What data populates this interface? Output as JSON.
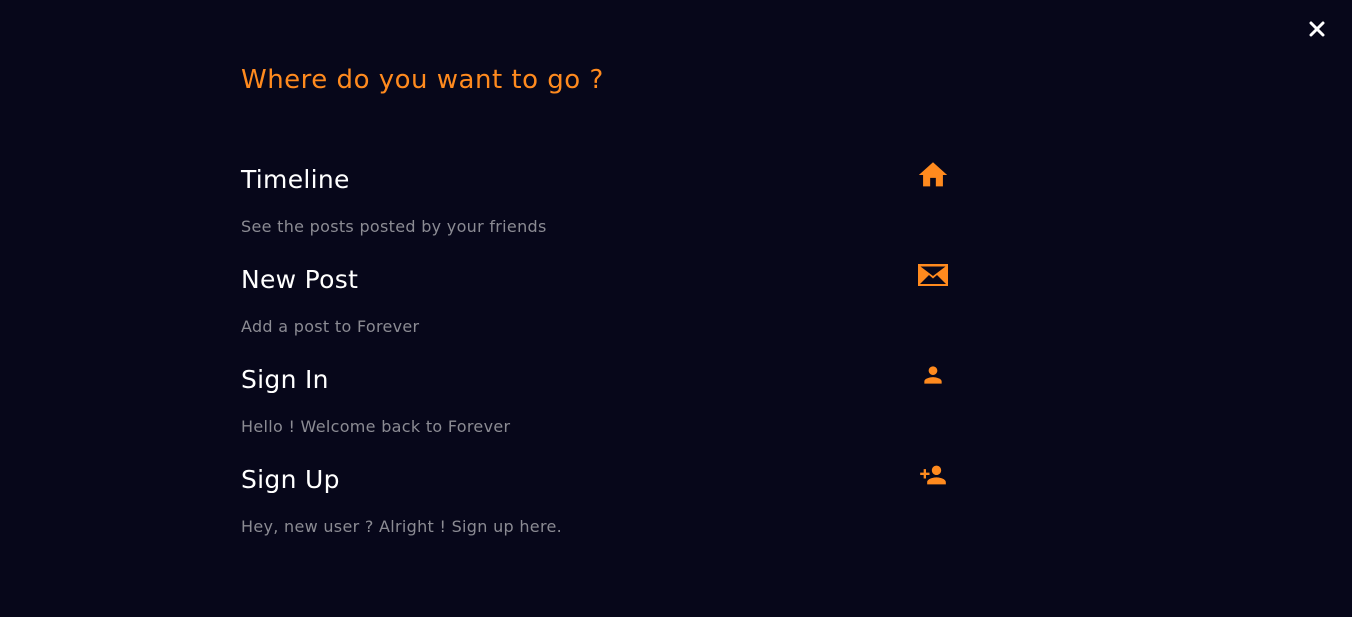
{
  "overlay": {
    "title": "Where do you want to go ?",
    "close_icon": "close-icon"
  },
  "colors": {
    "background": "#07071a",
    "accent": "#ff8a1e",
    "title_text": "#ffffff",
    "description_text": "#8b8b93",
    "close": "#ffffff"
  },
  "menu": {
    "items": [
      {
        "title": "Timeline",
        "description": "See the posts posted by your friends",
        "icon": "home-icon"
      },
      {
        "title": "New Post",
        "description": "Add a post to Forever",
        "icon": "mail-icon"
      },
      {
        "title": "Sign In",
        "description": "Hello ! Welcome back to Forever",
        "icon": "person-icon"
      },
      {
        "title": "Sign Up",
        "description": "Hey, new user ? Alright ! Sign up here.",
        "icon": "person-add-icon"
      }
    ]
  }
}
